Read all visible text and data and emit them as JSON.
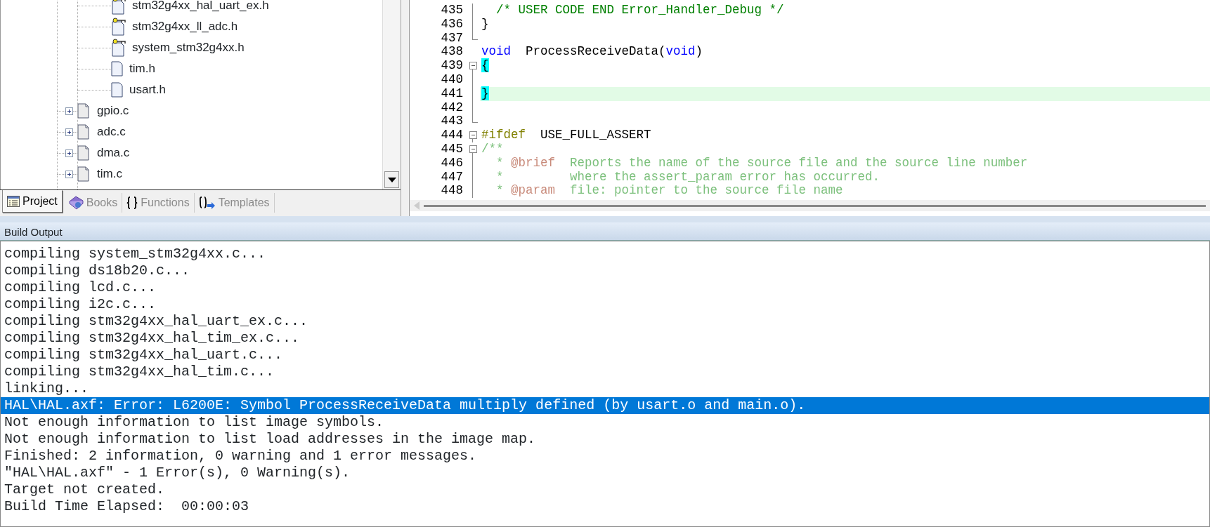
{
  "project_tree": {
    "files": [
      {
        "name": "stm32g4xx_hal_uart_ex.h",
        "kind": "header",
        "read_only": true
      },
      {
        "name": "stm32g4xx_ll_adc.h",
        "kind": "header",
        "read_only": true
      },
      {
        "name": "system_stm32g4xx.h",
        "kind": "header",
        "read_only": true
      },
      {
        "name": "tim.h",
        "kind": "header",
        "read_only": false
      },
      {
        "name": "usart.h",
        "kind": "header",
        "read_only": false
      },
      {
        "name": "gpio.c",
        "kind": "source",
        "expanded": false
      },
      {
        "name": "adc.c",
        "kind": "source",
        "expanded": false
      },
      {
        "name": "dma.c",
        "kind": "source",
        "expanded": false
      },
      {
        "name": "tim.c",
        "kind": "source",
        "expanded": false
      }
    ]
  },
  "project_tabs": [
    {
      "label": "Project",
      "selected": true
    },
    {
      "label": "Books",
      "selected": false
    },
    {
      "label": "Functions",
      "selected": false
    },
    {
      "label": "Templates",
      "selected": false
    }
  ],
  "editor": {
    "lines": [
      {
        "number": "435",
        "fold_line": true,
        "current": false,
        "tokens": [
          {
            "kind": "comment",
            "text": "  /* USER CODE END Error_Handler_Debug */"
          }
        ]
      },
      {
        "number": "436",
        "fold_line": true,
        "current": false,
        "tokens": [
          {
            "kind": "plain",
            "text": "}"
          }
        ]
      },
      {
        "number": "437",
        "fold_end": true,
        "current": false
      },
      {
        "number": "438",
        "current": false,
        "tokens": [
          {
            "kind": "keyword",
            "text": "void"
          },
          {
            "kind": "plain",
            "text": "  ProcessReceiveData("
          },
          {
            "kind": "keyword",
            "text": "void"
          },
          {
            "kind": "plain",
            "text": ")"
          }
        ]
      },
      {
        "number": "439",
        "fold_toggle": true,
        "current": false,
        "tokens": [
          {
            "kind": "brace_match",
            "text": "{"
          }
        ]
      },
      {
        "number": "440",
        "fold_line": true,
        "current": false
      },
      {
        "number": "441",
        "fold_line": true,
        "current": true,
        "tokens": [
          {
            "kind": "brace_match",
            "text": "}"
          }
        ]
      },
      {
        "number": "442",
        "fold_line": true,
        "current": false
      },
      {
        "number": "443",
        "fold_end": true,
        "current": false
      },
      {
        "number": "444",
        "fold_toggle": true,
        "current": false,
        "tokens": [
          {
            "kind": "preprocessor",
            "text": "#ifdef"
          },
          {
            "kind": "plain",
            "text": "  USE_FULL_ASSERT"
          }
        ]
      },
      {
        "number": "445",
        "fold_toggle": true,
        "current": false,
        "tokens": [
          {
            "kind": "doc_comment",
            "text": "/**"
          }
        ]
      },
      {
        "number": "446",
        "fold_line": true,
        "current": false,
        "tokens": [
          {
            "kind": "doc_comment",
            "text": "  * "
          },
          {
            "kind": "doc_tag",
            "text": "@brief"
          },
          {
            "kind": "doc_comment",
            "text": "  Reports the name of the source file and the source line number"
          }
        ]
      },
      {
        "number": "447",
        "fold_line": true,
        "current": false,
        "tokens": [
          {
            "kind": "doc_comment",
            "text": "  *         where the assert_param error has occurred."
          }
        ]
      },
      {
        "number": "448",
        "fold_line": true,
        "current": false,
        "tokens": [
          {
            "kind": "doc_comment",
            "text": "  * "
          },
          {
            "kind": "doc_tag",
            "text": "@param"
          },
          {
            "kind": "doc_comment",
            "text": "  file: pointer to the source file name"
          }
        ]
      }
    ]
  },
  "build_output": {
    "title": "Build Output",
    "lines": [
      {
        "text": "compiling system_stm32g4xx.c...",
        "selected": false
      },
      {
        "text": "compiling ds18b20.c...",
        "selected": false
      },
      {
        "text": "compiling lcd.c...",
        "selected": false
      },
      {
        "text": "compiling i2c.c...",
        "selected": false
      },
      {
        "text": "compiling stm32g4xx_hal_uart_ex.c...",
        "selected": false
      },
      {
        "text": "compiling stm32g4xx_hal_tim_ex.c...",
        "selected": false
      },
      {
        "text": "compiling stm32g4xx_hal_uart.c...",
        "selected": false
      },
      {
        "text": "compiling stm32g4xx_hal_tim.c...",
        "selected": false
      },
      {
        "text": "linking...",
        "selected": false
      },
      {
        "text": "HAL\\HAL.axf: Error: L6200E: Symbol ProcessReceiveData multiply defined (by usart.o and main.o).",
        "selected": true
      },
      {
        "text": "Not enough information to list image symbols.",
        "selected": false
      },
      {
        "text": "Not enough information to list load addresses in the image map.",
        "selected": false
      },
      {
        "text": "Finished: 2 information, 0 warning and 1 error messages.",
        "selected": false
      },
      {
        "text": "\"HAL\\HAL.axf\" - 1 Error(s), 0 Warning(s).",
        "selected": false
      },
      {
        "text": "Target not created.",
        "selected": false
      },
      {
        "text": "Build Time Elapsed:  00:00:03",
        "selected": false
      }
    ]
  }
}
